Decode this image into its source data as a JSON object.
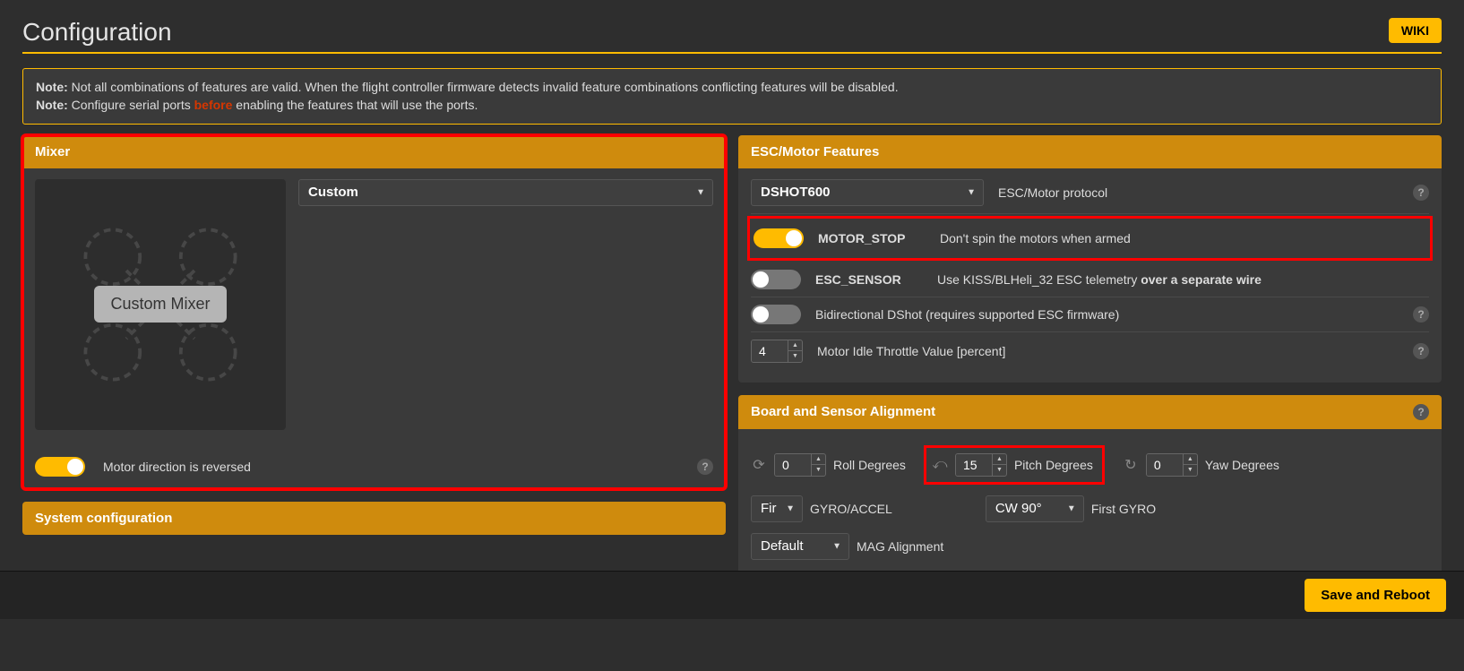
{
  "page": {
    "title": "Configuration",
    "wiki_label": "WIKI",
    "save_label": "Save and Reboot"
  },
  "note": {
    "prefix": "Note:",
    "line1_rest": " Not all combinations of features are valid. When the flight controller firmware detects invalid feature combinations conflicting features will be disabled.",
    "line2_a": " Configure serial ports ",
    "line2_warn": "before",
    "line2_b": " enabling the features that will use the ports."
  },
  "mixer": {
    "title": "Mixer",
    "select_value": "Custom",
    "badge": "Custom Mixer",
    "reverse_label": "Motor direction is reversed"
  },
  "esc": {
    "title": "ESC/Motor Features",
    "protocol_value": "DSHOT600",
    "protocol_label": "ESC/Motor protocol",
    "motor_stop_label": "MOTOR_STOP",
    "motor_stop_desc": "Don't spin the motors when armed",
    "esc_sensor_label": "ESC_SENSOR",
    "esc_sensor_desc_a": "Use KISS/BLHeli_32 ESC telemetry ",
    "esc_sensor_desc_b": "over a separate wire",
    "bidir_label": "Bidirectional DShot (requires supported ESC firmware)",
    "idle_value": "4",
    "idle_label": "Motor Idle Throttle Value [percent]"
  },
  "board": {
    "title": "Board and Sensor Alignment",
    "roll_value": "0",
    "roll_label": "Roll Degrees",
    "pitch_value": "15",
    "pitch_label": "Pitch Degrees",
    "yaw_value": "0",
    "yaw_label": "Yaw Degrees",
    "gyro_sel_value": "First",
    "gyro_accel_label": "GYRO/ACCEL",
    "first_gyro_value": "CW 90°",
    "first_gyro_label": "First GYRO",
    "mag_value": "Default",
    "mag_label": "MAG Alignment"
  },
  "system": {
    "title": "System configuration"
  }
}
